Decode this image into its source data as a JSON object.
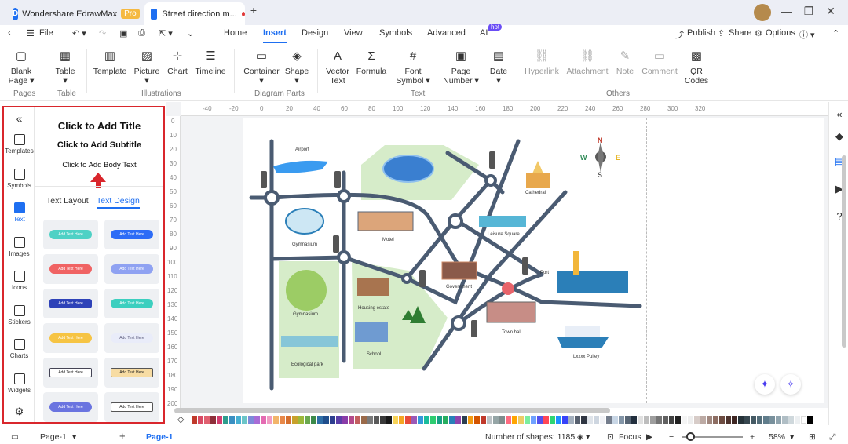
{
  "titlebar": {
    "app_name": "Wondershare EdrawMax",
    "pro_badge": "Pro",
    "doc_tab": "Street direction m...",
    "new_tab": "+",
    "min": "—",
    "max": "❐",
    "close": "✕"
  },
  "menubar": {
    "file": "File",
    "tabs": [
      "Home",
      "Insert",
      "Design",
      "View",
      "Symbols",
      "Advanced",
      "AI"
    ],
    "hot_badge": "hot",
    "publish": "Publish",
    "share": "Share",
    "options": "Options"
  },
  "ribbon": {
    "items": [
      {
        "label": "Blank\nPage ▾",
        "icon": "blank-page-icon"
      },
      {
        "label": "Table\n▾",
        "icon": "table-icon"
      },
      {
        "label": "Template",
        "icon": "template-icon"
      },
      {
        "label": "Picture\n▾",
        "icon": "picture-icon"
      },
      {
        "label": "Chart",
        "icon": "chart-icon"
      },
      {
        "label": "Timeline",
        "icon": "timeline-icon"
      },
      {
        "label": "Container\n▾",
        "icon": "container-icon"
      },
      {
        "label": "Shape\n▾",
        "icon": "shape-icon"
      },
      {
        "label": "Vector\nText",
        "icon": "vector-text-icon"
      },
      {
        "label": "Formula",
        "icon": "formula-icon"
      },
      {
        "label": "Font\nSymbol ▾",
        "icon": "font-symbol-icon"
      },
      {
        "label": "Page\nNumber ▾",
        "icon": "page-number-icon"
      },
      {
        "label": "Date\n▾",
        "icon": "date-icon"
      },
      {
        "label": "Hyperlink",
        "icon": "hyperlink-icon"
      },
      {
        "label": "Attachment",
        "icon": "attachment-icon"
      },
      {
        "label": "Note",
        "icon": "note-icon"
      },
      {
        "label": "Comment",
        "icon": "comment-icon"
      },
      {
        "label": "QR\nCodes",
        "icon": "qr-codes-icon"
      }
    ],
    "groups": [
      "Pages",
      "Table",
      "Illustrations",
      "Diagram Parts",
      "Text",
      "Others"
    ]
  },
  "sidebar": {
    "strip": [
      "Templates",
      "Symbols",
      "Text",
      "Images",
      "Icons",
      "Stickers",
      "Charts",
      "Widgets"
    ],
    "title": "Click to Add Title",
    "subtitle": "Click to Add Subtitle",
    "body": "Click to Add Body Text",
    "tabs": [
      "Text Layout",
      "Text Design"
    ],
    "tile_text": "Add Text Here"
  },
  "rulers": {
    "h": [
      "-40",
      "-20",
      "0",
      "20",
      "40",
      "60",
      "80",
      "100",
      "120",
      "140",
      "160",
      "180",
      "200",
      "220",
      "240",
      "260",
      "280",
      "300",
      "320"
    ],
    "v": [
      "0",
      "10",
      "20",
      "30",
      "40",
      "50",
      "60",
      "70",
      "80",
      "90",
      "100",
      "110",
      "120",
      "130",
      "140",
      "150",
      "160",
      "170",
      "180",
      "190",
      "200"
    ]
  },
  "map": {
    "labels": [
      "Airport",
      "Cathedral",
      "Gymnasium",
      "Motel",
      "Leisure Square",
      "Port",
      "Government",
      "Gymnasium",
      "Housing estate",
      "Town hall",
      "School",
      "Ecological park",
      "Lxxxx Pulley"
    ],
    "compass": [
      "N",
      "W",
      "E",
      "S"
    ]
  },
  "statusbar": {
    "page_tab": "Page-1",
    "page_active": "Page-1",
    "add": "+",
    "shapes": "Number of shapes: 1185",
    "focus": "Focus",
    "zoom": "58%"
  },
  "colors": {
    "accent": "#1e6ff1",
    "sidebar_border": "#d9262c",
    "road": "#4a5b72"
  }
}
